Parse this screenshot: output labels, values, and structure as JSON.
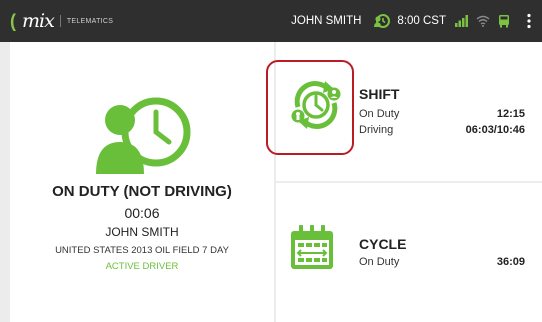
{
  "topbar": {
    "logo_text": "mix",
    "logo_sub": "TELEMATICS",
    "driver_name": "JOHN SMITH",
    "time": "8:00 CST",
    "icons": [
      "clock-person-icon",
      "signal-icon",
      "wifi-icon",
      "vehicle-icon",
      "more-vert-icon"
    ]
  },
  "status": {
    "title": "ON DUTY (NOT DRIVING)",
    "elapsed": "00:06",
    "driver_name": "JOHN SMITH",
    "ruleset": "UNITED STATES 2013 OIL FIELD 7 DAY",
    "active_label": "ACTIVE DRIVER"
  },
  "shift": {
    "title": "SHIFT",
    "rows": [
      {
        "label": "On Duty",
        "value": "12:15"
      },
      {
        "label": "Driving",
        "value": "06:03/10:46"
      }
    ]
  },
  "cycle": {
    "title": "CYCLE",
    "rows": [
      {
        "label": "On Duty",
        "value": "36:09"
      }
    ]
  },
  "colors": {
    "accent_green": "#6abf3a",
    "topbar_bg": "#2f2f2f",
    "highlight_red": "#b81c24"
  }
}
